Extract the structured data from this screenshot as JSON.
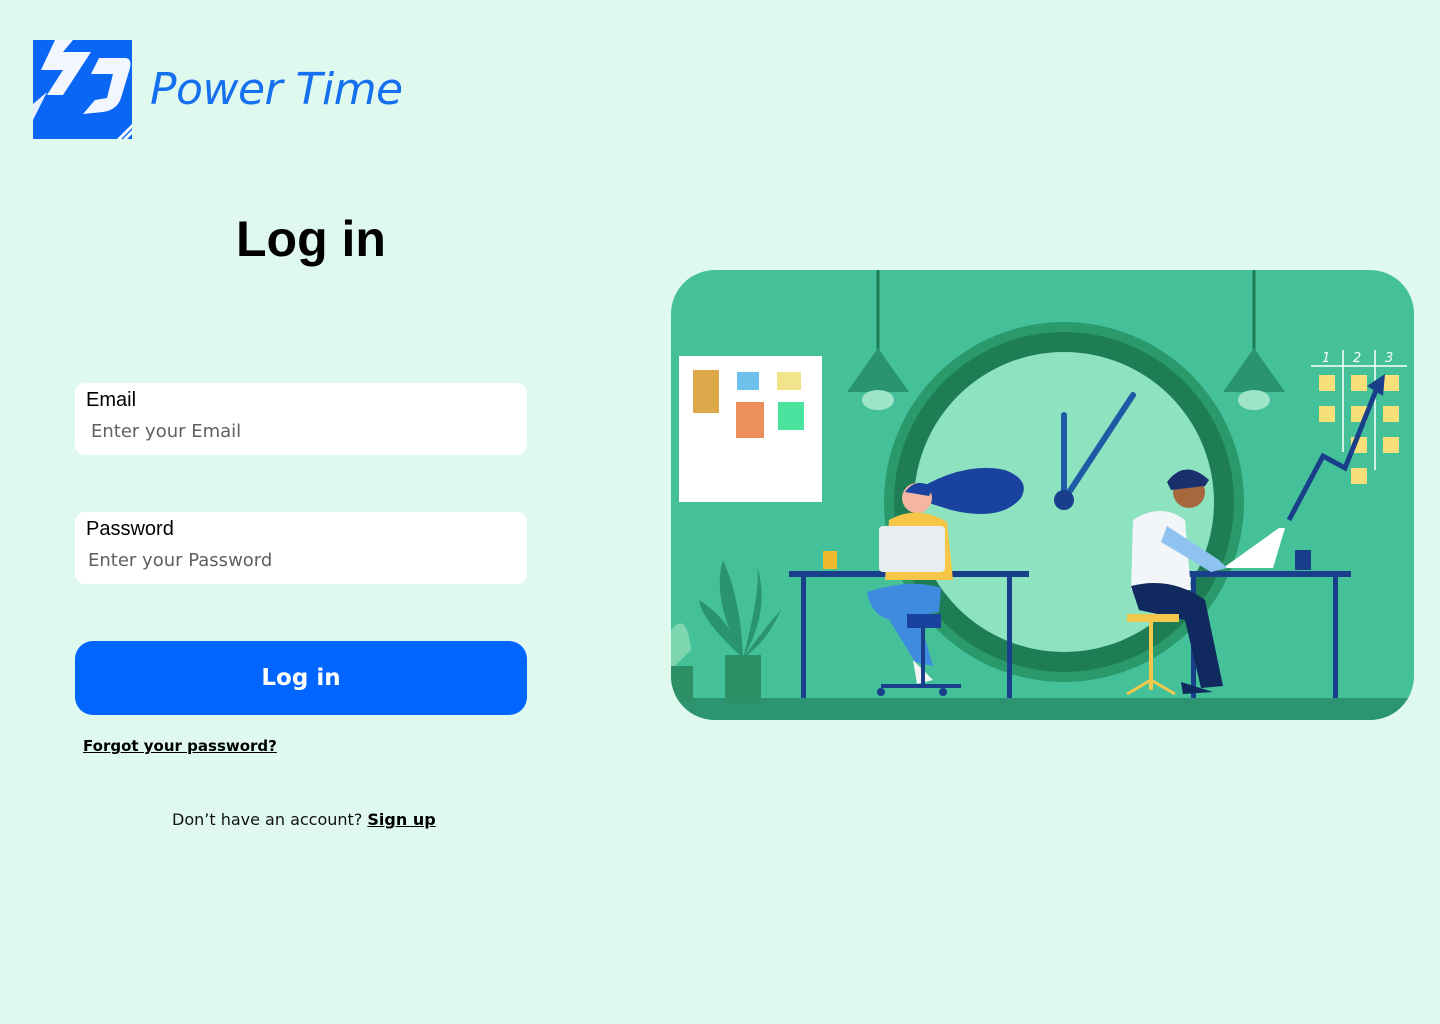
{
  "brand": {
    "name": "Power Time",
    "color": "#1570ef"
  },
  "form": {
    "title": "Log in",
    "email": {
      "label": "Email",
      "placeholder": "Enter your Email",
      "value": ""
    },
    "password": {
      "label": "Password",
      "placeholder": "Enter your Password",
      "value": ""
    },
    "submit_label": "Log in",
    "forgot_label": "Forgot your password?",
    "signup_prompt": "Don’t have an account?",
    "signup_label": "Sign up"
  },
  "illustration": {
    "board_columns": [
      "1",
      "2",
      "3"
    ]
  },
  "colors": {
    "background": "#dff9ee",
    "accent": "#0066ff",
    "illustration_bg": "#45c19a"
  }
}
